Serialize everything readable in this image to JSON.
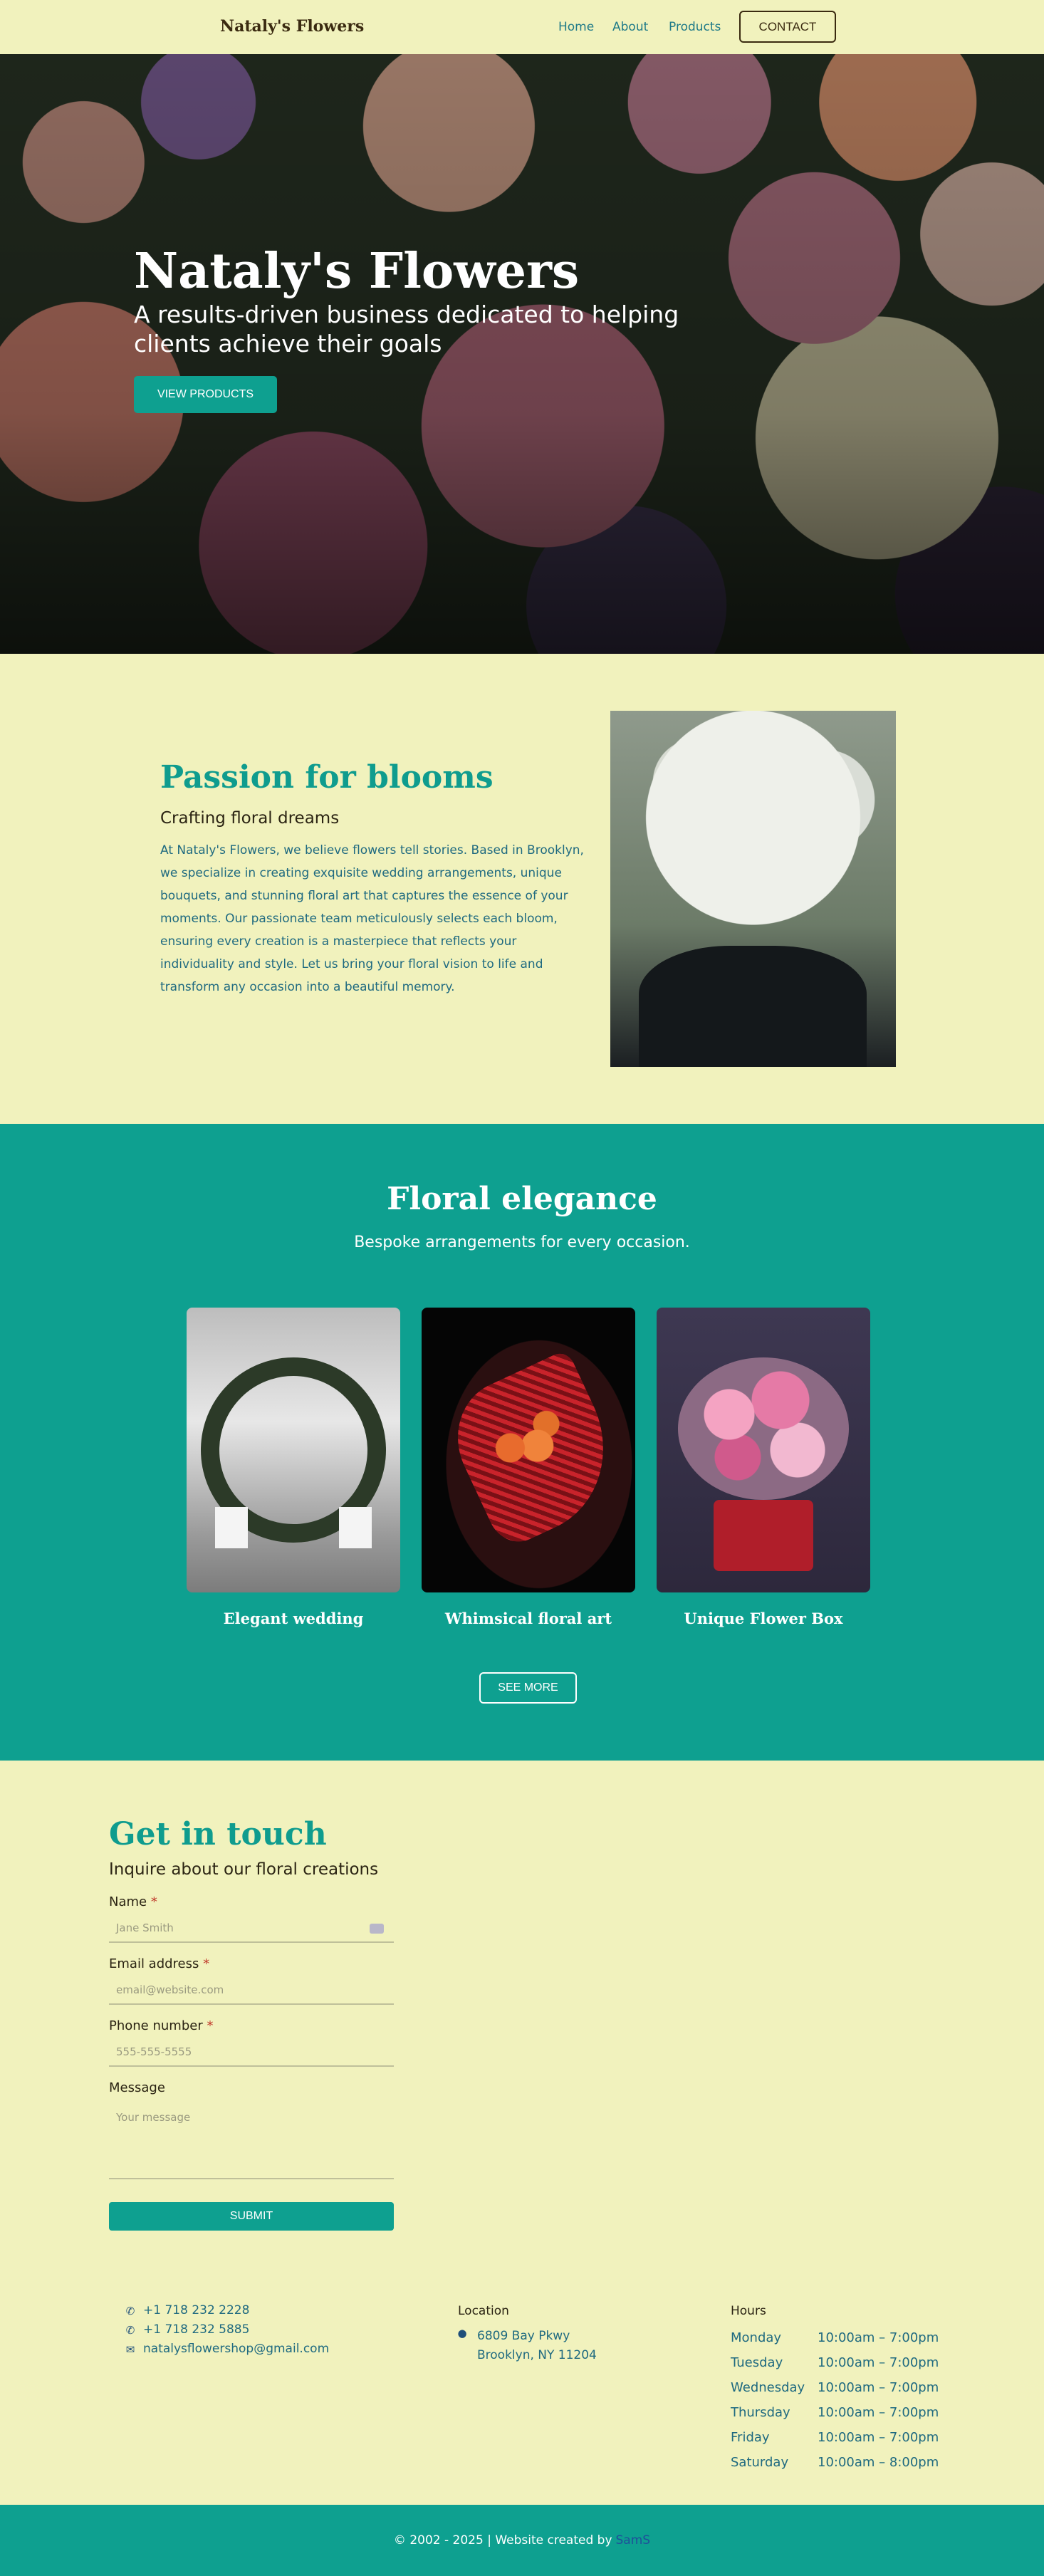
{
  "nav": {
    "brand": "Nataly's Flowers",
    "links": [
      "Home",
      "About",
      "Products"
    ],
    "contact": "CONTACT"
  },
  "hero": {
    "title": "Nataly's Flowers",
    "subtitle": "A results-driven business dedicated to helping clients achieve their goals",
    "button": "VIEW PRODUCTS"
  },
  "passion": {
    "title": "Passion for blooms",
    "subtitle": "Crafting floral dreams",
    "body": "At Nataly's Flowers, we believe flowers tell stories. Based in Brooklyn, we specialize in creating exquisite wedding arrangements, unique bouquets, and stunning floral art that captures the essence of your moments. Our passionate team meticulously selects each bloom, ensuring every creation is a masterpiece that reflects your individuality and style. Let us bring your floral vision to life and transform any occasion into a beautiful memory."
  },
  "elegance": {
    "title": "Floral elegance",
    "subtitle": "Bespoke arrangements for every occasion.",
    "cards": [
      {
        "label": "Elegant wedding"
      },
      {
        "label": "Whimsical floral art"
      },
      {
        "label": "Unique Flower Box"
      }
    ],
    "see_more": "SEE MORE"
  },
  "contact_form": {
    "title": "Get in touch",
    "subtitle": "Inquire about our floral creations",
    "required_mark": "*",
    "fields": [
      {
        "label": "Name",
        "placeholder": "Jane Smith",
        "required": true
      },
      {
        "label": "Email address",
        "placeholder": "email@website.com",
        "required": true
      },
      {
        "label": "Phone number",
        "placeholder": "555-555-5555",
        "required": true
      },
      {
        "label": "Message",
        "placeholder": "Your message",
        "required": false
      }
    ],
    "submit": "SUBMIT"
  },
  "contact_info": {
    "phones": [
      "+1 718 232 2228",
      "+1 718 232 5885"
    ],
    "email": "natalysflowershop@gmail.com",
    "location_heading": "Location",
    "address_line1": "6809 Bay Pkwy",
    "address_line2": "Brooklyn, NY 11204",
    "hours_heading": "Hours",
    "hours": [
      {
        "day": "Monday",
        "time": "10:00am – 7:00pm"
      },
      {
        "day": "Tuesday",
        "time": "10:00am – 7:00pm"
      },
      {
        "day": "Wednesday",
        "time": "10:00am – 7:00pm"
      },
      {
        "day": "Thursday",
        "time": "10:00am – 7:00pm"
      },
      {
        "day": "Friday",
        "time": "10:00am – 7:00pm"
      },
      {
        "day": "Saturday",
        "time": "10:00am – 8:00pm"
      }
    ]
  },
  "footer": {
    "text": "© 2002 - 2025 | Website created by",
    "credit": "SamS"
  },
  "colors": {
    "background": "#f1f2bd",
    "accent": "#0ea090",
    "link": "#1f7a88"
  },
  "icons": [
    "phone-icon",
    "email-icon",
    "location-pin-icon",
    "autofill-icon"
  ]
}
